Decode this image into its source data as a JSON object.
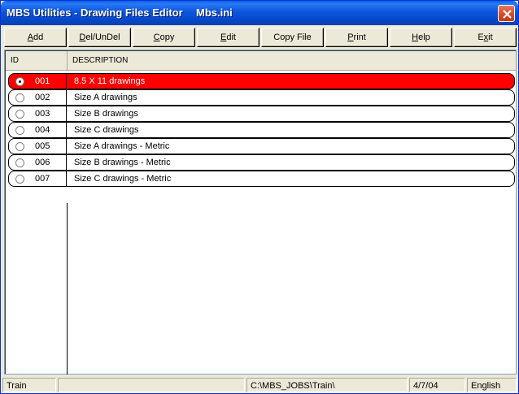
{
  "window": {
    "title": "MBS Utilities - Drawing Files Editor",
    "file": "Mbs.ini"
  },
  "toolbar": [
    {
      "key": "add",
      "pre": "",
      "ul": "A",
      "post": "dd"
    },
    {
      "key": "delundel",
      "pre": "",
      "ul": "D",
      "post": "el/UnDel"
    },
    {
      "key": "copy",
      "pre": "",
      "ul": "C",
      "post": "opy"
    },
    {
      "key": "edit",
      "pre": "",
      "ul": "E",
      "post": "dit"
    },
    {
      "key": "copyfile",
      "pre": "Copy File",
      "ul": "",
      "post": ""
    },
    {
      "key": "print",
      "pre": "",
      "ul": "P",
      "post": "rint"
    },
    {
      "key": "help",
      "pre": "",
      "ul": "H",
      "post": "elp"
    },
    {
      "key": "exit",
      "pre": "E",
      "ul": "x",
      "post": "it"
    }
  ],
  "grid": {
    "columns": {
      "id": "ID",
      "description": "DESCRIPTION"
    },
    "rows": [
      {
        "id": "001",
        "description": "8.5 X 11 drawings",
        "selected": true
      },
      {
        "id": "002",
        "description": "Size A drawings",
        "selected": false
      },
      {
        "id": "003",
        "description": "Size B drawings",
        "selected": false
      },
      {
        "id": "004",
        "description": "Size C drawings",
        "selected": false
      },
      {
        "id": "005",
        "description": "Size A drawings - Metric",
        "selected": false
      },
      {
        "id": "006",
        "description": "Size B drawings - Metric",
        "selected": false
      },
      {
        "id": "007",
        "description": "Size C drawings - Metric",
        "selected": false
      }
    ]
  },
  "status": {
    "job": "Train",
    "blank": "",
    "path": "C:\\MBS_JOBS\\Train\\",
    "date": "4/7/04",
    "language": "English"
  },
  "colors": {
    "selected_row": "#ff0000",
    "titlebar": "#0b55dd"
  }
}
